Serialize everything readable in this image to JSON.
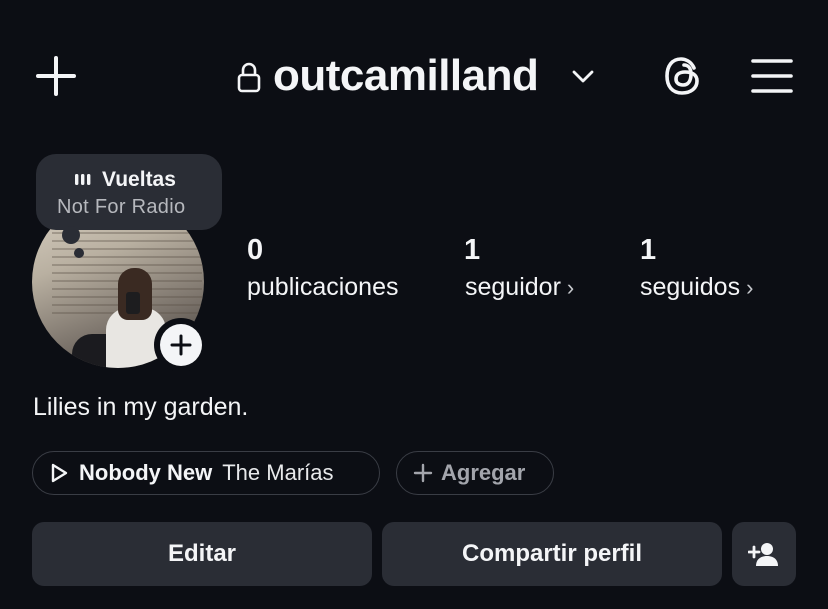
{
  "header": {
    "username": "outcamilland",
    "icons": [
      "add-icon",
      "lock-icon",
      "chevron-down-icon",
      "threads-icon",
      "menu-icon"
    ]
  },
  "note": {
    "song": "Vueltas",
    "artist": "Not For Radio"
  },
  "stats": {
    "posts_count": "0",
    "posts_label": "publicaciones",
    "followers_count": "1",
    "followers_label": "seguidor",
    "following_count": "1",
    "following_label": "seguidos"
  },
  "bio": "Lilies in my garden.",
  "music": {
    "title": "Nobody New",
    "artist": "The Marías"
  },
  "add_link": {
    "label": "Agregar"
  },
  "buttons": {
    "edit": "Editar",
    "share": "Compartir perfil"
  },
  "colors": {
    "background": "#0c0e14",
    "button_bg": "#2a2d35",
    "text": "#f4f5f7",
    "muted": "#b6b8bd"
  }
}
